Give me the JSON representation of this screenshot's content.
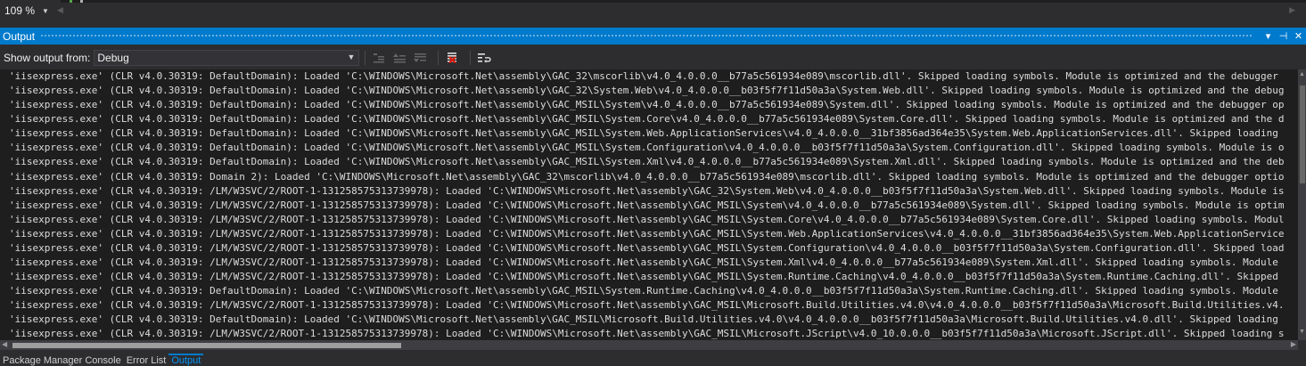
{
  "editor": {
    "zoom": "109 %"
  },
  "output_panel": {
    "title": "Output",
    "buttons": [
      "▾",
      "⊣",
      "✕"
    ],
    "show_output_from_label": "Show output from:",
    "source": "Debug"
  },
  "output_lines": [
    "'iisexpress.exe' (CLR v4.0.30319: DefaultDomain): Loaded 'C:\\WINDOWS\\Microsoft.Net\\assembly\\GAC_32\\mscorlib\\v4.0_4.0.0.0__b77a5c561934e089\\mscorlib.dll'. Skipped loading symbols. Module is optimized and the debugger",
    "'iisexpress.exe' (CLR v4.0.30319: DefaultDomain): Loaded 'C:\\WINDOWS\\Microsoft.Net\\assembly\\GAC_32\\System.Web\\v4.0_4.0.0.0__b03f5f7f11d50a3a\\System.Web.dll'. Skipped loading symbols. Module is optimized and the debug",
    "'iisexpress.exe' (CLR v4.0.30319: DefaultDomain): Loaded 'C:\\WINDOWS\\Microsoft.Net\\assembly\\GAC_MSIL\\System\\v4.0_4.0.0.0__b77a5c561934e089\\System.dll'. Skipped loading symbols. Module is optimized and the debugger op",
    "'iisexpress.exe' (CLR v4.0.30319: DefaultDomain): Loaded 'C:\\WINDOWS\\Microsoft.Net\\assembly\\GAC_MSIL\\System.Core\\v4.0_4.0.0.0__b77a5c561934e089\\System.Core.dll'. Skipped loading symbols. Module is optimized and the d",
    "'iisexpress.exe' (CLR v4.0.30319: DefaultDomain): Loaded 'C:\\WINDOWS\\Microsoft.Net\\assembly\\GAC_MSIL\\System.Web.ApplicationServices\\v4.0_4.0.0.0__31bf3856ad364e35\\System.Web.ApplicationServices.dll'. Skipped loading",
    "'iisexpress.exe' (CLR v4.0.30319: DefaultDomain): Loaded 'C:\\WINDOWS\\Microsoft.Net\\assembly\\GAC_MSIL\\System.Configuration\\v4.0_4.0.0.0__b03f5f7f11d50a3a\\System.Configuration.dll'. Skipped loading symbols. Module is o",
    "'iisexpress.exe' (CLR v4.0.30319: DefaultDomain): Loaded 'C:\\WINDOWS\\Microsoft.Net\\assembly\\GAC_MSIL\\System.Xml\\v4.0_4.0.0.0__b77a5c561934e089\\System.Xml.dll'. Skipped loading symbols. Module is optimized and the deb",
    "'iisexpress.exe' (CLR v4.0.30319: Domain 2): Loaded 'C:\\WINDOWS\\Microsoft.Net\\assembly\\GAC_32\\mscorlib\\v4.0_4.0.0.0__b77a5c561934e089\\mscorlib.dll'. Skipped loading symbols. Module is optimized and the debugger optio",
    "'iisexpress.exe' (CLR v4.0.30319: /LM/W3SVC/2/ROOT-1-131258575313739978): Loaded 'C:\\WINDOWS\\Microsoft.Net\\assembly\\GAC_32\\System.Web\\v4.0_4.0.0.0__b03f5f7f11d50a3a\\System.Web.dll'. Skipped loading symbols. Module is",
    "'iisexpress.exe' (CLR v4.0.30319: /LM/W3SVC/2/ROOT-1-131258575313739978): Loaded 'C:\\WINDOWS\\Microsoft.Net\\assembly\\GAC_MSIL\\System\\v4.0_4.0.0.0__b77a5c561934e089\\System.dll'. Skipped loading symbols. Module is optim",
    "'iisexpress.exe' (CLR v4.0.30319: /LM/W3SVC/2/ROOT-1-131258575313739978): Loaded 'C:\\WINDOWS\\Microsoft.Net\\assembly\\GAC_MSIL\\System.Core\\v4.0_4.0.0.0__b77a5c561934e089\\System.Core.dll'. Skipped loading symbols. Modul",
    "'iisexpress.exe' (CLR v4.0.30319: /LM/W3SVC/2/ROOT-1-131258575313739978): Loaded 'C:\\WINDOWS\\Microsoft.Net\\assembly\\GAC_MSIL\\System.Web.ApplicationServices\\v4.0_4.0.0.0__31bf3856ad364e35\\System.Web.ApplicationService",
    "'iisexpress.exe' (CLR v4.0.30319: /LM/W3SVC/2/ROOT-1-131258575313739978): Loaded 'C:\\WINDOWS\\Microsoft.Net\\assembly\\GAC_MSIL\\System.Configuration\\v4.0_4.0.0.0__b03f5f7f11d50a3a\\System.Configuration.dll'. Skipped load",
    "'iisexpress.exe' (CLR v4.0.30319: /LM/W3SVC/2/ROOT-1-131258575313739978): Loaded 'C:\\WINDOWS\\Microsoft.Net\\assembly\\GAC_MSIL\\System.Xml\\v4.0_4.0.0.0__b77a5c561934e089\\System.Xml.dll'. Skipped loading symbols. Module",
    "'iisexpress.exe' (CLR v4.0.30319: /LM/W3SVC/2/ROOT-1-131258575313739978): Loaded 'C:\\WINDOWS\\Microsoft.Net\\assembly\\GAC_MSIL\\System.Runtime.Caching\\v4.0_4.0.0.0__b03f5f7f11d50a3a\\System.Runtime.Caching.dll'. Skipped",
    "'iisexpress.exe' (CLR v4.0.30319: DefaultDomain): Loaded 'C:\\WINDOWS\\Microsoft.Net\\assembly\\GAC_MSIL\\System.Runtime.Caching\\v4.0_4.0.0.0__b03f5f7f11d50a3a\\System.Runtime.Caching.dll'. Skipped loading symbols. Module",
    "'iisexpress.exe' (CLR v4.0.30319: /LM/W3SVC/2/ROOT-1-131258575313739978): Loaded 'C:\\WINDOWS\\Microsoft.Net\\assembly\\GAC_MSIL\\Microsoft.Build.Utilities.v4.0\\v4.0_4.0.0.0__b03f5f7f11d50a3a\\Microsoft.Build.Utilities.v4.",
    "'iisexpress.exe' (CLR v4.0.30319: DefaultDomain): Loaded 'C:\\WINDOWS\\Microsoft.Net\\assembly\\GAC_MSIL\\Microsoft.Build.Utilities.v4.0\\v4.0_4.0.0.0__b03f5f7f11d50a3a\\Microsoft.Build.Utilities.v4.0.dll'. Skipped loading",
    "'iisexpress.exe' (CLR v4.0.30319: /LM/W3SVC/2/ROOT-1-131258575313739978): Loaded 'C:\\WINDOWS\\Microsoft.Net\\assembly\\GAC_MSIL\\Microsoft.JScript\\v4.0_10.0.0.0__b03f5f7f11d50a3a\\Microsoft.JScript.dll'. Skipped loading s"
  ],
  "bottom_tabs": [
    {
      "label": "Package Manager Console",
      "active": false
    },
    {
      "label": "Error List",
      "active": false
    },
    {
      "label": "Output",
      "active": true
    }
  ],
  "colors": {
    "accent": "#007acc",
    "background": "#1e1e1e",
    "chrome": "#2d2d30",
    "text": "#dcdcdc"
  },
  "icons": [
    "chevron-down-icon",
    "find-message-icon",
    "previous-message-icon",
    "next-message-icon",
    "clear-all-icon",
    "word-wrap-icon",
    "pin-icon",
    "close-icon"
  ]
}
